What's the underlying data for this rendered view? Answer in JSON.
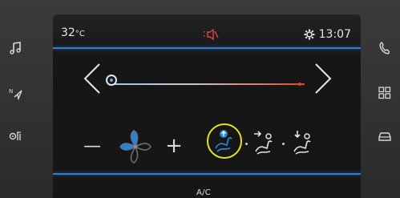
{
  "status": {
    "temperature": "32",
    "temperature_unit": "°C",
    "clock": "13:07"
  },
  "controls": {
    "fan_minus_label": "—",
    "fan_plus_label": "+",
    "ac_label": "A/C"
  },
  "temperature_slider": {
    "level": 0.0
  },
  "side_left": [
    "music-icon",
    "navigation-icon",
    "fan-settings-icon"
  ],
  "side_right": [
    "phone-icon",
    "apps-grid-icon",
    "car-icon"
  ],
  "colors": {
    "accent": "#2f7fd0",
    "cold": "#9ec9ef",
    "hot": "#e8442c",
    "highlight": "#e8e41c"
  }
}
